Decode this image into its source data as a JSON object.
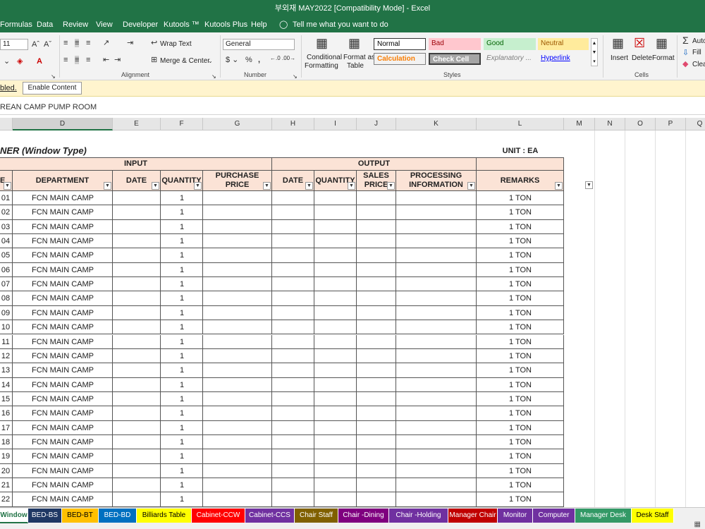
{
  "window": {
    "title": "부외재 MAY2022  [Compatibility Mode]  -  Excel"
  },
  "menu": {
    "items": [
      "Formulas",
      "Data",
      "Review",
      "View",
      "Developer",
      "Kutools ™",
      "Kutools Plus",
      "Help"
    ],
    "tell_me": "Tell me what you want to do"
  },
  "ribbon": {
    "font_size": "11",
    "number_format": "General",
    "wrap_text": "Wrap Text",
    "merge_center": "Merge & Center",
    "alignment_label": "Alignment",
    "number_label": "Number",
    "conditional_formatting": [
      "Conditional",
      "Formatting"
    ],
    "format_as_table": [
      "Format as",
      "Table"
    ],
    "styles": {
      "normal": "Normal",
      "bad": "Bad",
      "good": "Good",
      "neutral": "Neutral",
      "calculation": "Calculation",
      "check_cell": "Check Cell",
      "explanatory": "Explanatory ...",
      "hyperlink": "Hyperlink"
    },
    "styles_label": "Styles",
    "insert": "Insert",
    "delete": "Delete",
    "format": "Format",
    "cells_label": "Cells",
    "autosum": "Auto",
    "fill": "Fill",
    "clear": "Clea"
  },
  "message_bar": {
    "text": "bled.",
    "button": "Enable Content"
  },
  "formula_bar": {
    "content": "REAN CAMP PUMP ROOM"
  },
  "columns": [
    "D",
    "E",
    "F",
    "G",
    "H",
    "I",
    "J",
    "K",
    "L",
    "M",
    "N",
    "O",
    "P",
    "Q"
  ],
  "sheet": {
    "title": "NER (Window Type)",
    "unit": "UNIT : EA",
    "input_header": "INPUT",
    "output_header": "OUTPUT",
    "col_headers": {
      "c": "E",
      "department": "DEPARTMENT",
      "date_in": "DATE",
      "quantity_in": "QUANTITY",
      "purchase_price": "PURCHASE PRICE",
      "date_out": "DATE",
      "quantity_out": "QUANTITY",
      "sales_price": "SALES PRICE",
      "processing_info": "PROCESSING INFORMATION",
      "remarks": "REMARKS"
    },
    "rows": [
      {
        "no": "01",
        "dept": "FCN MAIN CAMP",
        "qty": "1",
        "remarks": "1 TON"
      },
      {
        "no": "02",
        "dept": "FCN MAIN CAMP",
        "qty": "1",
        "remarks": "1 TON"
      },
      {
        "no": "03",
        "dept": "FCN MAIN CAMP",
        "qty": "1",
        "remarks": "1 TON"
      },
      {
        "no": "04",
        "dept": "FCN MAIN CAMP",
        "qty": "1",
        "remarks": "1 TON"
      },
      {
        "no": "05",
        "dept": "FCN MAIN CAMP",
        "qty": "1",
        "remarks": "1 TON"
      },
      {
        "no": "06",
        "dept": "FCN MAIN CAMP",
        "qty": "1",
        "remarks": "1 TON"
      },
      {
        "no": "07",
        "dept": "FCN MAIN CAMP",
        "qty": "1",
        "remarks": "1 TON"
      },
      {
        "no": "08",
        "dept": "FCN MAIN CAMP",
        "qty": "1",
        "remarks": "1 TON"
      },
      {
        "no": "09",
        "dept": "FCN MAIN CAMP",
        "qty": "1",
        "remarks": "1 TON"
      },
      {
        "no": "10",
        "dept": "FCN MAIN CAMP",
        "qty": "1",
        "remarks": "1 TON"
      },
      {
        "no": "11",
        "dept": "FCN MAIN CAMP",
        "qty": "1",
        "remarks": "1 TON"
      },
      {
        "no": "12",
        "dept": "FCN MAIN CAMP",
        "qty": "1",
        "remarks": "1 TON"
      },
      {
        "no": "13",
        "dept": "FCN MAIN CAMP",
        "qty": "1",
        "remarks": "1 TON"
      },
      {
        "no": "14",
        "dept": "FCN MAIN CAMP",
        "qty": "1",
        "remarks": "1 TON"
      },
      {
        "no": "15",
        "dept": "FCN MAIN CAMP",
        "qty": "1",
        "remarks": "1 TON"
      },
      {
        "no": "16",
        "dept": "FCN MAIN CAMP",
        "qty": "1",
        "remarks": "1 TON"
      },
      {
        "no": "17",
        "dept": "FCN MAIN CAMP",
        "qty": "1",
        "remarks": "1 TON"
      },
      {
        "no": "18",
        "dept": "FCN MAIN CAMP",
        "qty": "1",
        "remarks": "1 TON"
      },
      {
        "no": "19",
        "dept": "FCN MAIN CAMP",
        "qty": "1",
        "remarks": "1 TON"
      },
      {
        "no": "20",
        "dept": "FCN MAIN CAMP",
        "qty": "1",
        "remarks": "1 TON"
      },
      {
        "no": "21",
        "dept": "FCN MAIN CAMP",
        "qty": "1",
        "remarks": "1 TON"
      },
      {
        "no": "22",
        "dept": "FCN MAIN CAMP",
        "qty": "1",
        "remarks": "1 TON"
      }
    ]
  },
  "tabs": [
    {
      "label": "Window",
      "color": "#ffffff",
      "text": "#217346",
      "active": true
    },
    {
      "label": "BED-BS",
      "color": "#1f3864",
      "text": "#ffffff"
    },
    {
      "label": "BED-BT",
      "color": "#ffc000",
      "text": "#000000"
    },
    {
      "label": "BED-BD",
      "color": "#0070c0",
      "text": "#ffffff"
    },
    {
      "label": "Billiards Table",
      "color": "#ffff00",
      "text": "#000000"
    },
    {
      "label": "Cabinet-CCW",
      "color": "#ff0000",
      "text": "#ffffff"
    },
    {
      "label": "Cabinet-CCS",
      "color": "#7030a0",
      "text": "#ffffff"
    },
    {
      "label": "Chair Staff",
      "color": "#806000",
      "text": "#ffffff"
    },
    {
      "label": "Chair -Dining",
      "color": "#7f007f",
      "text": "#ffffff"
    },
    {
      "label": "Chair -Holding",
      "color": "#7030a0",
      "text": "#ffffff"
    },
    {
      "label": "Manager Chair",
      "color": "#c00000",
      "text": "#ffffff"
    },
    {
      "label": "Monitor",
      "color": "#7030a0",
      "text": "#ffffff"
    },
    {
      "label": "Computer",
      "color": "#7030a0",
      "text": "#ffffff"
    },
    {
      "label": "Manager Desk",
      "color": "#339966",
      "text": "#ffffff"
    },
    {
      "label": "Desk Staff",
      "color": "#ffff00",
      "text": "#000000"
    }
  ]
}
